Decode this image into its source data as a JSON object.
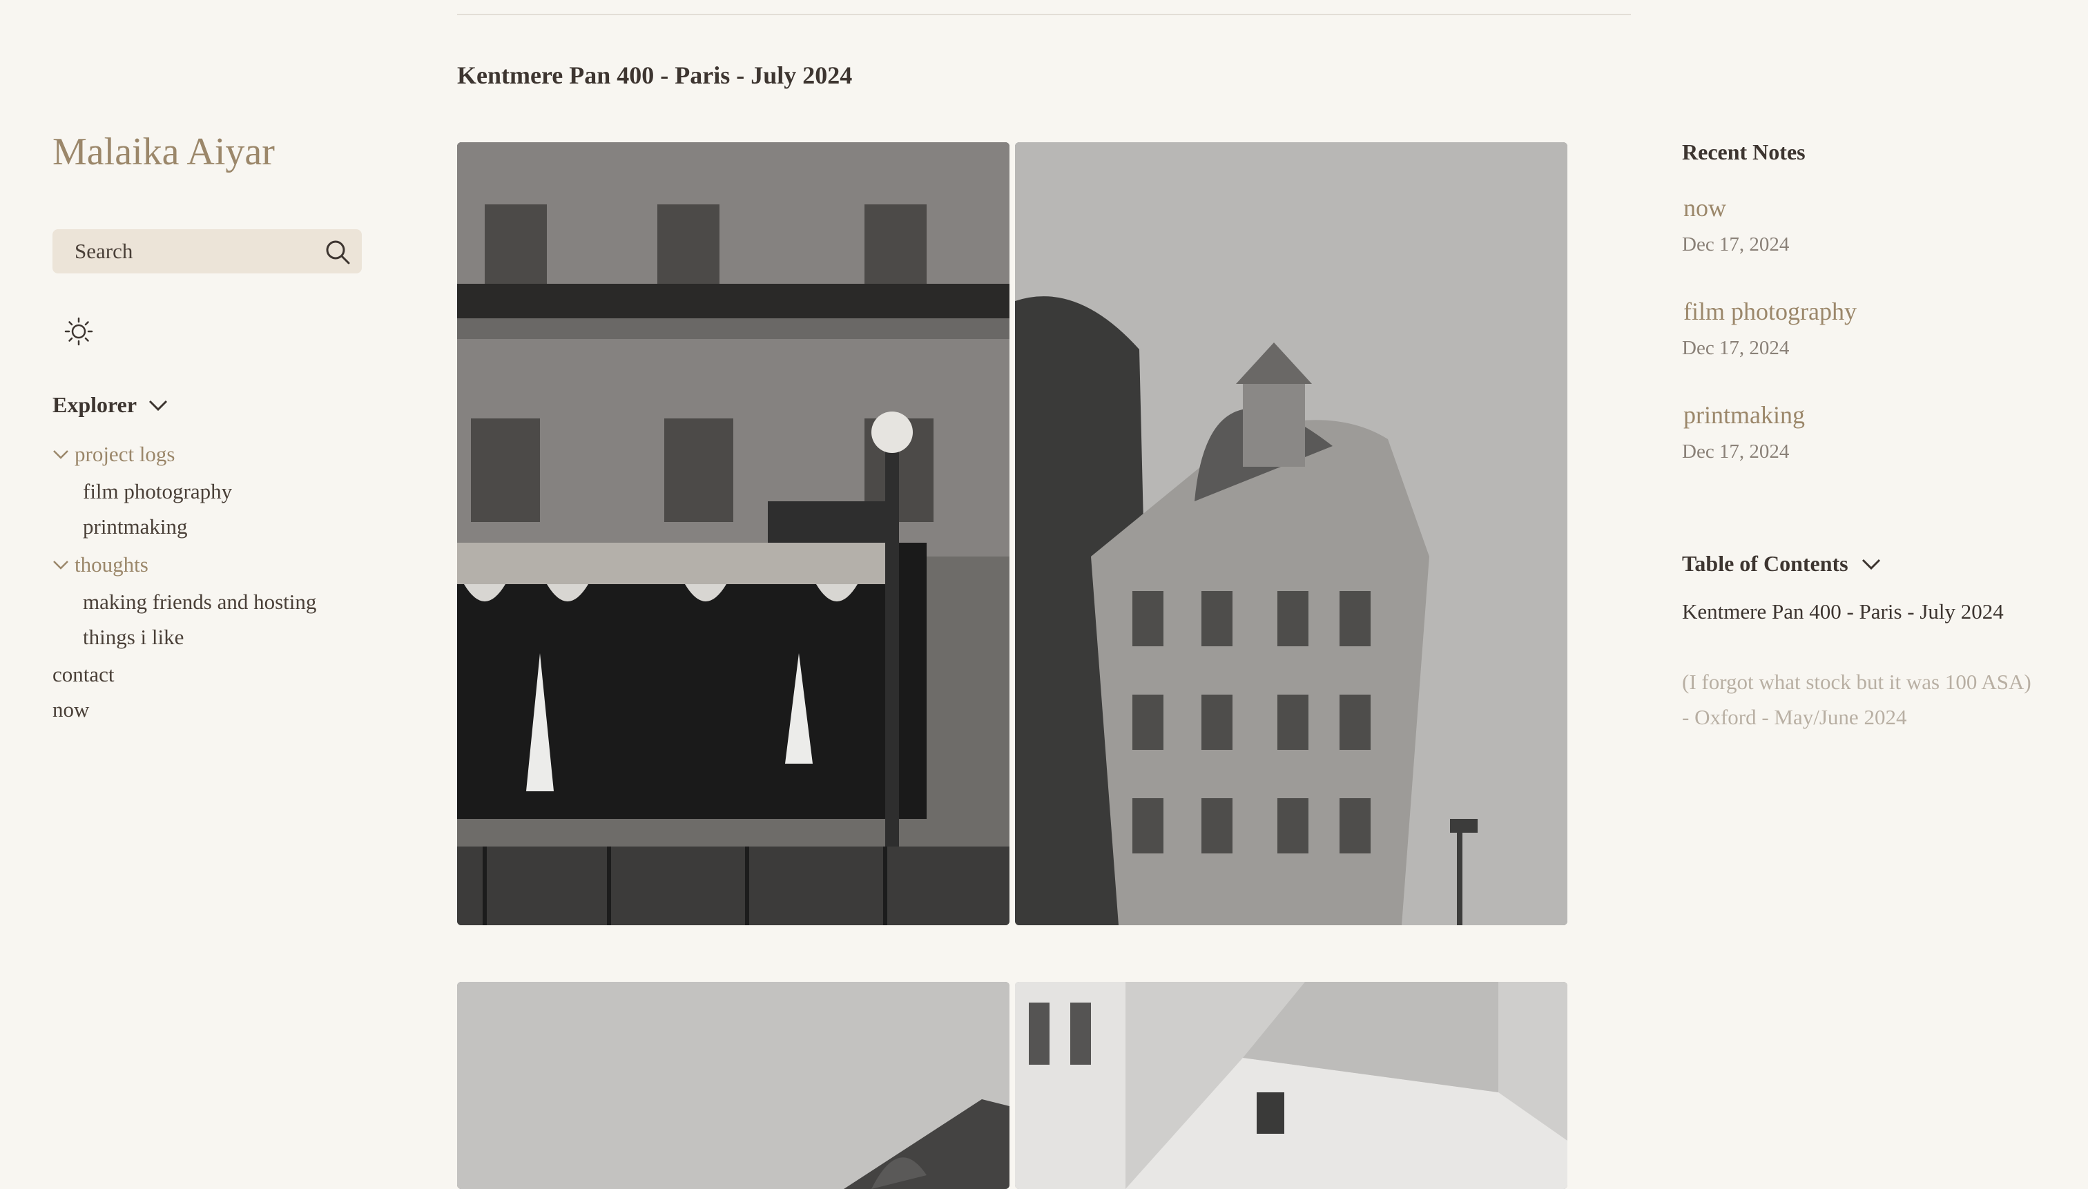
{
  "site": {
    "title": "Malaika Aiyar"
  },
  "search": {
    "label": "Search"
  },
  "explorer": {
    "title": "Explorer",
    "tree": [
      {
        "label": "project logs",
        "type": "folder"
      },
      {
        "label": "film photography",
        "type": "file"
      },
      {
        "label": "printmaking",
        "type": "file"
      },
      {
        "label": "thoughts",
        "type": "folder"
      },
      {
        "label": "making friends and hosting",
        "type": "file"
      },
      {
        "label": "things i like",
        "type": "file"
      },
      {
        "label": "contact",
        "type": "file"
      },
      {
        "label": "now",
        "type": "file"
      }
    ]
  },
  "main": {
    "heading": "Kentmere Pan 400 - Paris - July 2024"
  },
  "recent_notes": {
    "title": "Recent Notes",
    "items": [
      {
        "title": "now",
        "date": "Dec 17, 2024"
      },
      {
        "title": "film photography",
        "date": "Dec 17, 2024"
      },
      {
        "title": "printmaking",
        "date": "Dec 17, 2024"
      }
    ]
  },
  "toc": {
    "title": "Table of Contents",
    "items": [
      {
        "label": "Kentmere Pan 400 - Paris - July 2024",
        "active": true
      },
      {
        "label": "(I forgot what stock but it was 100 ASA) - Oxford - May/June 2024",
        "active": false
      }
    ]
  },
  "colors": {
    "accent": "#9b876a",
    "background": "#f8f6f1",
    "search_bg": "#ece4d8"
  }
}
